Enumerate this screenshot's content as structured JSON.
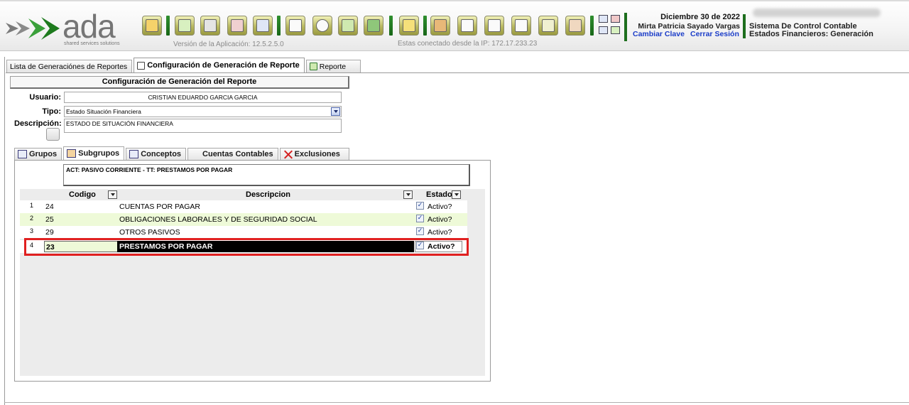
{
  "header": {
    "logo_text": "ada",
    "logo_tagline": "shared services solutions",
    "version_text": "Versión de la Aplicación: 12.5.2.5.0",
    "ip_text": "Estas conectado desde la IP: 172.17.233.23",
    "date": "Diciembre 30 de 2022",
    "user_name": "Mirta Patricia Sayado Vargas",
    "change_password": "Cambiar Clave",
    "logout": "Cerrar Sesión",
    "system_name": "Sistema De Control Contable",
    "module_name": "Estados Financieros: Generación",
    "toolbar_icons": [
      "folder-icon",
      "add-icon",
      "save-icon",
      "cancel-icon",
      "undo-icon",
      "print-icon",
      "search-icon",
      "export-icon",
      "open-icon",
      "lock-icon",
      "money-icon",
      "camera-icon",
      "grid-icon",
      "cart-icon",
      "settings-icon",
      "users-icon"
    ],
    "accent_color": "#1d6e1d",
    "link_color": "#1a3cc8"
  },
  "outer_tabs": [
    {
      "label": "Lista de Generaciónes de Reportes",
      "icon": "list-icon"
    },
    {
      "label": "Configuración de Generación de Reporte",
      "icon": "document-icon"
    },
    {
      "label": "Reporte",
      "icon": "report-icon"
    }
  ],
  "config": {
    "title": "Configuración de Generación del Reporte",
    "usuario_label": "Usuario:",
    "usuario_value": "CRISTIAN EDUARDO GARCIA GARCIA",
    "tipo_label": "Tipo:",
    "tipo_value": "Estado Situación Financiera",
    "descripcion_label": "Descripción:",
    "descripcion_value": "ESTADO DE SITUACIÓN FINANCIERA"
  },
  "inner_tabs": [
    {
      "label": "Grupos",
      "icon": "numbered-list-icon"
    },
    {
      "label": "Subgrupos",
      "icon": "subgroups-icon"
    },
    {
      "label": "Conceptos",
      "icon": "concepts-icon"
    },
    {
      "label": "Cuentas Contables",
      "icon": "table-icon"
    },
    {
      "label": "Exclusiones",
      "icon": "x-icon"
    }
  ],
  "context_text": "ACT: PASIVO CORRIENTE - TT: PRESTAMOS POR PAGAR",
  "grid": {
    "columns": {
      "codigo": "Codigo",
      "descripcion": "Descripcion",
      "estado": "Estado"
    },
    "rows": [
      {
        "num": "1",
        "codigo": "24",
        "descripcion": "CUENTAS POR PAGAR",
        "checked": true,
        "estado": "Activo?"
      },
      {
        "num": "2",
        "codigo": "25",
        "descripcion": "OBLIGACIONES LABORALES Y DE SEGURIDAD SOCIAL",
        "checked": true,
        "estado": "Activo?"
      },
      {
        "num": "3",
        "codigo": "29",
        "descripcion": "OTROS PASIVOS",
        "checked": true,
        "estado": "Activo?"
      },
      {
        "num": "4",
        "codigo": "23",
        "descripcion": "PRESTAMOS POR PAGAR",
        "checked": true,
        "estado": "Activo?"
      }
    ],
    "selected_row": 4,
    "highlight_color": "#e02020"
  }
}
